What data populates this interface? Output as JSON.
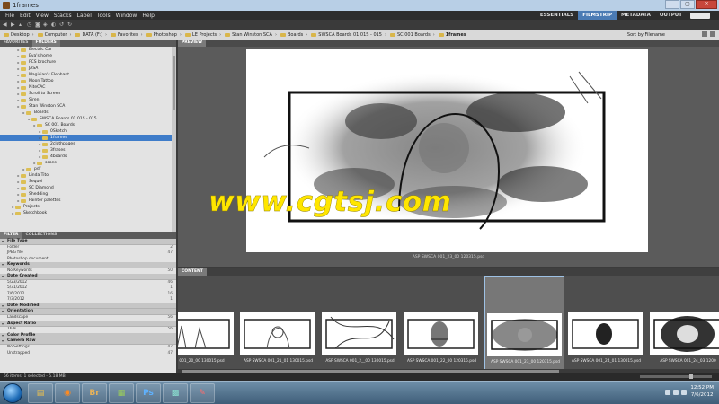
{
  "window": {
    "title": "1frames"
  },
  "menu": [
    "File",
    "Edit",
    "View",
    "Stacks",
    "Label",
    "Tools",
    "Window",
    "Help"
  ],
  "workspaces": {
    "items": [
      "ESSENTIALS",
      "FILMSTRIP",
      "METADATA",
      "OUTPUT"
    ],
    "active": "FILMSTRIP"
  },
  "breadcrumbs": [
    "Desktop",
    "Computer",
    "DATA (F:)",
    "Favorites",
    "Photoshop",
    "LE Projects",
    "Stan Winston SCA",
    "Boards",
    "SWSCA Boards 01 01S - 015",
    "SC 001 Boards",
    "1frames"
  ],
  "sort_label": "Sort by Filename",
  "left_panel": {
    "tabs": [
      "FAVORITES",
      "FOLDERS"
    ],
    "active_tab": "FOLDERS",
    "folders": [
      {
        "label": "Electric Car",
        "indent": 3
      },
      {
        "label": "Eva's home",
        "indent": 3
      },
      {
        "label": "FCS brochure",
        "indent": 3
      },
      {
        "label": "JASA",
        "indent": 3
      },
      {
        "label": "Magician's Elephant",
        "indent": 3
      },
      {
        "label": "Moon Tattoo",
        "indent": 3
      },
      {
        "label": "NiteCAC",
        "indent": 3
      },
      {
        "label": "Scroll to Screen",
        "indent": 3
      },
      {
        "label": "Siren",
        "indent": 3
      },
      {
        "label": "Stan Winston SCA",
        "indent": 3
      },
      {
        "label": "Boards",
        "indent": 4
      },
      {
        "label": "SWSCA Boards 01 01S - 015",
        "indent": 5
      },
      {
        "label": "SC 001 Boards",
        "indent": 6
      },
      {
        "label": "0Sketch",
        "indent": 7
      },
      {
        "label": "1frames",
        "indent": 7,
        "selected": true
      },
      {
        "label": "2clothpages",
        "indent": 7
      },
      {
        "label": "3frases",
        "indent": 7
      },
      {
        "label": "4boards",
        "indent": 7
      },
      {
        "label": "scans",
        "indent": 6
      },
      {
        "label": "pdf",
        "indent": 4
      },
      {
        "label": "Linda Tito",
        "indent": 3
      },
      {
        "label": "Sequel",
        "indent": 3
      },
      {
        "label": "SC Diamond",
        "indent": 3
      },
      {
        "label": "Shedding",
        "indent": 3
      },
      {
        "label": "Painter palettes",
        "indent": 3
      },
      {
        "label": "Projects",
        "indent": 2
      },
      {
        "label": "Sketchbook",
        "indent": 2
      }
    ]
  },
  "filter_panel": {
    "tabs": [
      "FILTER",
      "COLLECTIONS"
    ],
    "active_tab": "FILTER",
    "sections": [
      {
        "heading": "File Type",
        "items": [
          {
            "label": "Folder",
            "count": "2"
          },
          {
            "label": "JPEG file",
            "count": "47"
          },
          {
            "label": "Photoshop document",
            "count": ""
          }
        ]
      },
      {
        "heading": "Keywords",
        "items": [
          {
            "label": "No Keywords",
            "count": "50"
          }
        ]
      },
      {
        "heading": "Date Created",
        "items": [
          {
            "label": "5/23/2012",
            "count": "46"
          },
          {
            "label": "5/31/2012",
            "count": "1"
          },
          {
            "label": "7/6/2012",
            "count": "16"
          },
          {
            "label": "7/3/2012",
            "count": "1"
          }
        ]
      },
      {
        "heading": "Date Modified",
        "items": []
      },
      {
        "heading": "Orientation",
        "items": [
          {
            "label": "Landscape",
            "count": "56"
          }
        ]
      },
      {
        "heading": "Aspect Ratio",
        "items": [
          {
            "label": "16:9",
            "count": "56"
          }
        ]
      },
      {
        "heading": "Color Profile",
        "items": []
      },
      {
        "heading": "Camera Raw",
        "items": [
          {
            "label": "No Settings",
            "count": "47"
          },
          {
            "label": "Unstrapped",
            "count": "47"
          }
        ]
      }
    ]
  },
  "preview": {
    "tab": "PREVIEW",
    "caption": "ASP SWSCA 001_23_00 120315.psd"
  },
  "watermark": "www.cgtsj.com",
  "content": {
    "tab": "CONTENT",
    "thumbnails": [
      {
        "label": "SCA 001_20_00 130015.psd"
      },
      {
        "label": "ASP SWSCA 001_21_01 130015.psd"
      },
      {
        "label": "ASP SWSCA 001_2__00 130015.psd"
      },
      {
        "label": "ASP SWSCA 001_22_00 120315.psd"
      },
      {
        "label": "ASP SWSCA 001_23_00 120315.psd",
        "selected": true
      },
      {
        "label": "ASP SWSCA 001_24_01 130015.psd"
      },
      {
        "label": "ASP SWSCA 001_24_03 1200"
      }
    ]
  },
  "status": {
    "text": "56 items, 1 selected - 5.18 MB"
  },
  "taskbar": {
    "apps": [
      {
        "name": "explorer",
        "glyph": "▤",
        "color": "#f0c24b"
      },
      {
        "name": "firefox",
        "glyph": "◉",
        "color": "#ff8a1f"
      },
      {
        "name": "bridge",
        "glyph": "Br",
        "color": "#e6b25a"
      },
      {
        "name": "files",
        "glyph": "▦",
        "color": "#9acd5a"
      },
      {
        "name": "photoshop",
        "glyph": "Ps",
        "color": "#5fb2ff"
      },
      {
        "name": "network",
        "glyph": "▩",
        "color": "#8be0d0"
      },
      {
        "name": "settings",
        "glyph": "✎",
        "color": "#ff6b6b"
      }
    ],
    "clock_time": "12:52 PM",
    "clock_date": "7/6/2012"
  }
}
